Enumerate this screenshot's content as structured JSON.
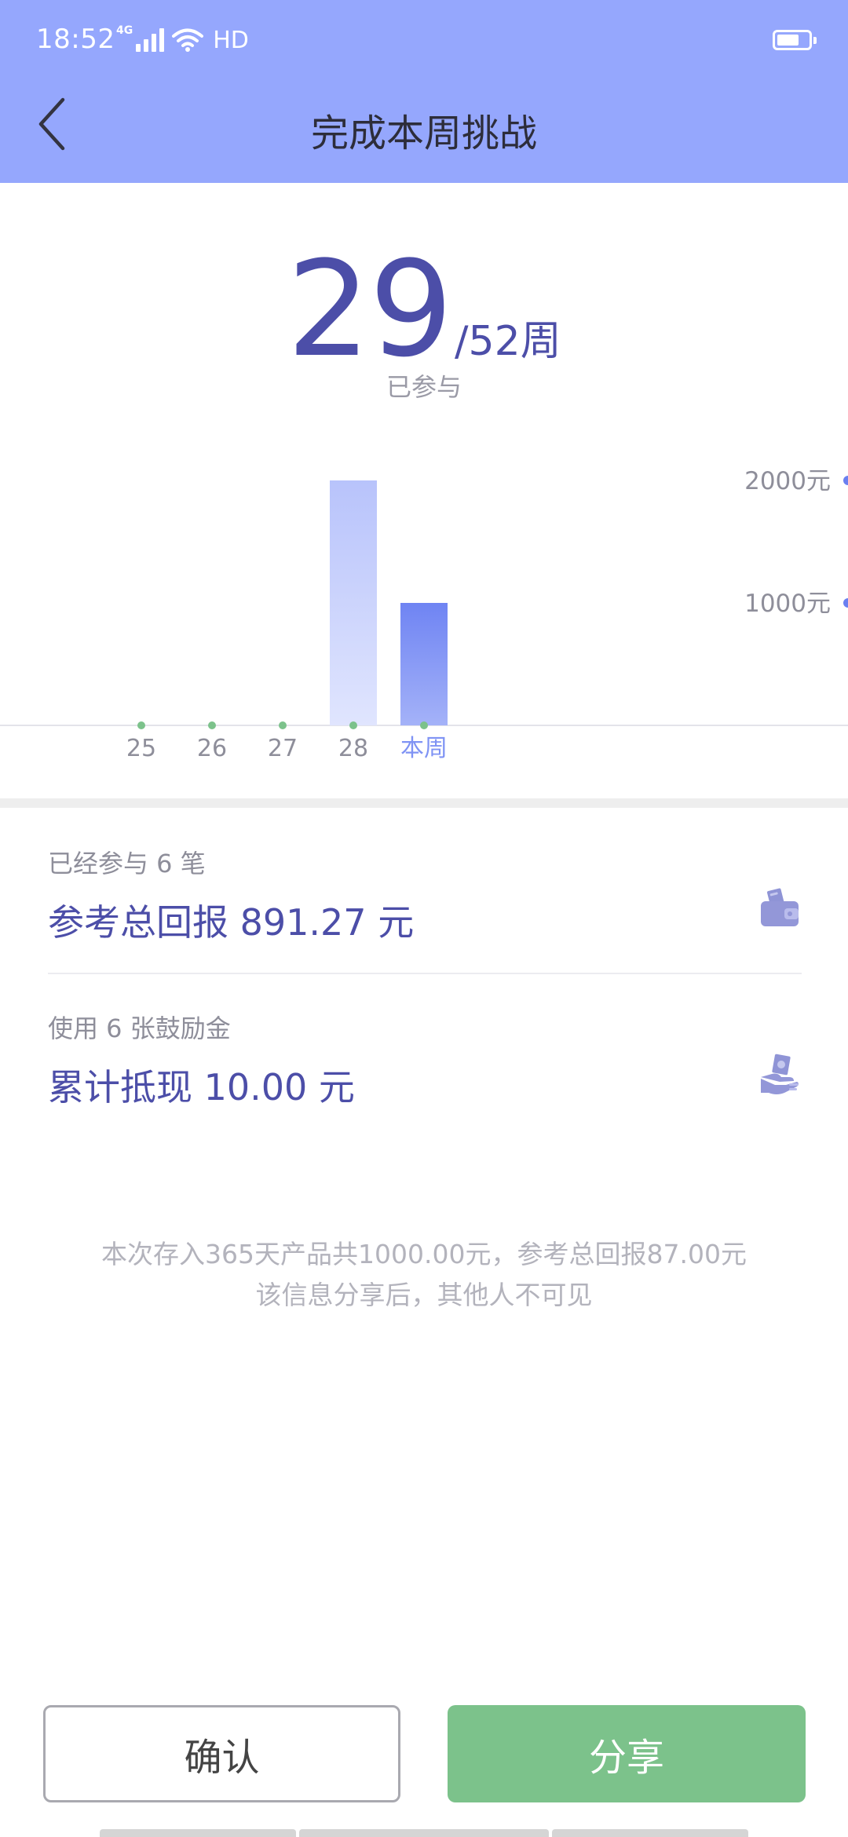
{
  "status_bar": {
    "time": "18:52",
    "network": "4G",
    "hd": "HD",
    "battery_level": 0.7
  },
  "header": {
    "title": "完成本周挑战",
    "background_color": "#95a7fd"
  },
  "progress": {
    "count": "29",
    "total": "/52周",
    "label": "已参与"
  },
  "chart_data": {
    "type": "bar",
    "categories": [
      "25",
      "26",
      "27",
      "28",
      "本周"
    ],
    "values": [
      0,
      0,
      0,
      2000,
      1000
    ],
    "y_ticks": [
      "2000元",
      "1000元"
    ],
    "y_tick_values": [
      2000,
      1000
    ],
    "ylim": [
      0,
      2000
    ],
    "highlight_category": "本周",
    "colors": {
      "bar_light": "#bfc9fb",
      "bar_highlight": "#7287f3",
      "dot": "#7cc28b",
      "axis_dot": "#6a7ff0"
    }
  },
  "stats": {
    "participated": "已经参与 6 笔",
    "total_return": "参考总回报 891.27 元",
    "coupons_used": "使用 6 张鼓励金",
    "total_deduction": "累计抵现 10.00 元"
  },
  "icons": {
    "wallet": "wallet-icon",
    "cash_hand": "cash-hand-icon"
  },
  "notice": {
    "line1": "本次存入365天产品共1000.00元，参考总回报87.00元",
    "line2": "该信息分享后，其他人不可见"
  },
  "buttons": {
    "confirm": "确认",
    "share": "分享",
    "share_color": "#7cc28b"
  }
}
